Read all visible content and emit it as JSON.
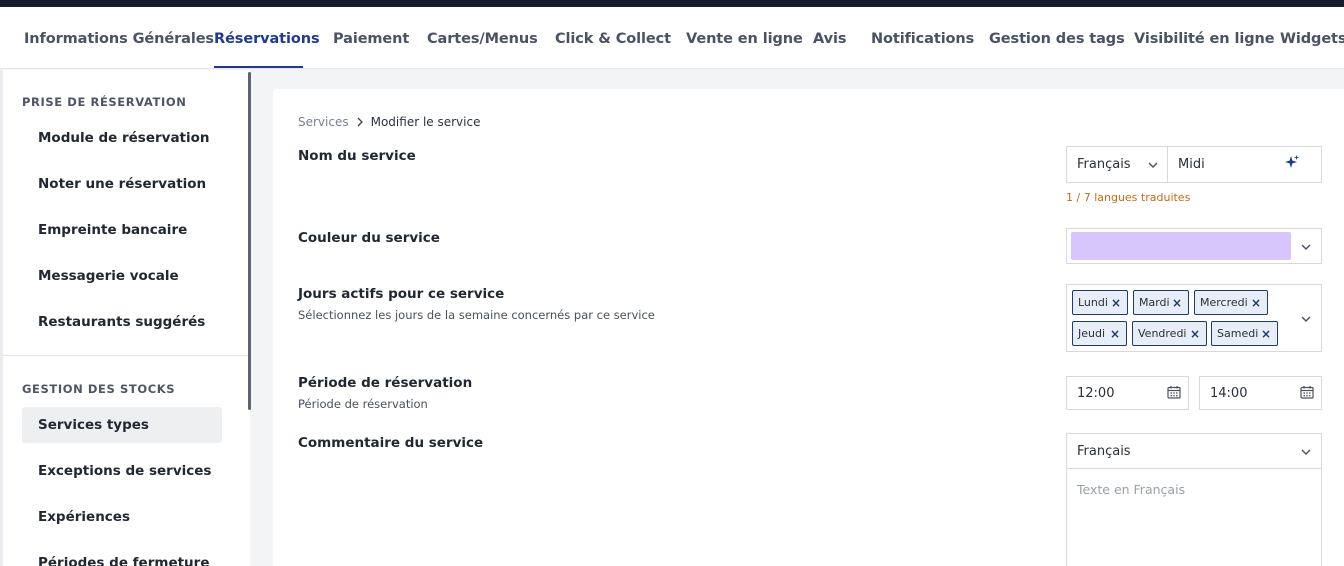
{
  "tabs": [
    {
      "label": "Informations Générales",
      "active": false
    },
    {
      "label": "Réservations",
      "active": true
    },
    {
      "label": "Paiement",
      "active": false
    },
    {
      "label": "Cartes/Menus",
      "active": false
    },
    {
      "label": "Click & Collect",
      "active": false
    },
    {
      "label": "Vente en ligne",
      "active": false
    },
    {
      "label": "Avis",
      "active": false
    },
    {
      "label": "Notifications",
      "active": false
    },
    {
      "label": "Gestion des tags",
      "active": false
    },
    {
      "label": "Visibilité en ligne",
      "active": false
    },
    {
      "label": "Widgets",
      "active": false
    }
  ],
  "sidebar": {
    "sections": [
      {
        "heading": "PRISE DE RÉSERVATION",
        "items": [
          {
            "label": "Module de réservation",
            "selected": false
          },
          {
            "label": "Noter une réservation",
            "selected": false
          },
          {
            "label": "Empreinte bancaire",
            "selected": false
          },
          {
            "label": "Messagerie vocale",
            "selected": false
          },
          {
            "label": "Restaurants suggérés",
            "selected": false
          }
        ]
      },
      {
        "heading": "GESTION DES STOCKS",
        "items": [
          {
            "label": "Services types",
            "selected": true
          },
          {
            "label": "Exceptions de services",
            "selected": false
          },
          {
            "label": "Expériences",
            "selected": false
          },
          {
            "label": "Périodes de fermeture",
            "selected": false
          }
        ]
      }
    ]
  },
  "breadcrumb": {
    "parent": "Services",
    "current": "Modifier le service"
  },
  "form": {
    "service_name": {
      "label": "Nom du service",
      "language": "Français",
      "value": "Midi",
      "hint": "1 / 7 langues traduites"
    },
    "service_color": {
      "label": "Couleur du service",
      "value": "#d6c6fb"
    },
    "active_days": {
      "label": "Jours actifs pour ce service",
      "sublabel": "Sélectionnez les jours de la semaine concernés par ce service",
      "chips": [
        "Lundi",
        "Mardi",
        "Mercredi",
        "Jeudi",
        "Vendredi",
        "Samedi"
      ]
    },
    "booking_period": {
      "label": "Période de réservation",
      "sublabel": "Période de réservation",
      "start": "12:00",
      "end": "14:00"
    },
    "comment": {
      "label": "Commentaire du service",
      "language": "Français",
      "placeholder": "Texte en Français"
    }
  },
  "colors": {
    "accent": "#1f3a93",
    "chip_border": "#1f3a6e",
    "hint": "#c66a14",
    "top_strip": "#151c2c"
  },
  "icons": {
    "sparkle": "sparkle-icon",
    "chevron": "chevron-down-icon",
    "calendar": "calendar-icon",
    "close": "close-icon"
  }
}
